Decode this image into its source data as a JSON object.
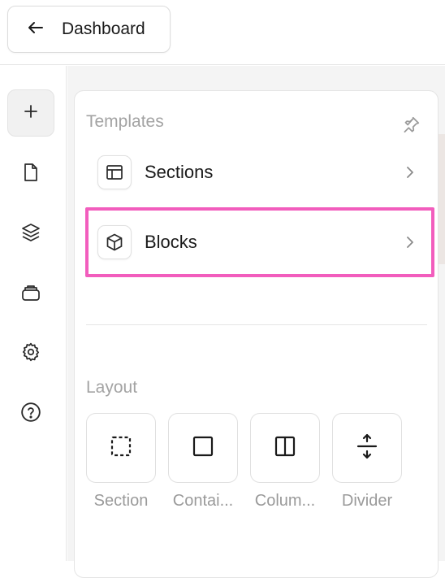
{
  "header": {
    "back_label": "Dashboard"
  },
  "rail": {
    "items": [
      {
        "icon": "plus-icon",
        "active": true
      },
      {
        "icon": "file-icon"
      },
      {
        "icon": "layers-icon"
      },
      {
        "icon": "stack-icon"
      },
      {
        "icon": "gear-icon"
      },
      {
        "icon": "help-icon"
      }
    ]
  },
  "panel": {
    "templates": {
      "title": "Templates",
      "items": [
        {
          "label": "Sections",
          "icon": "layout-icon"
        },
        {
          "label": "Blocks",
          "icon": "cube-icon"
        }
      ]
    },
    "layout": {
      "title": "Layout",
      "items": [
        {
          "label": "Section",
          "icon": "dashed-square-icon"
        },
        {
          "label": "Contai...",
          "icon": "square-icon"
        },
        {
          "label": "Colum...",
          "icon": "columns-icon"
        },
        {
          "label": "Divider",
          "icon": "divider-icon"
        }
      ]
    }
  },
  "colors": {
    "highlight": "#f25dbd",
    "muted": "#a3a3a3"
  }
}
